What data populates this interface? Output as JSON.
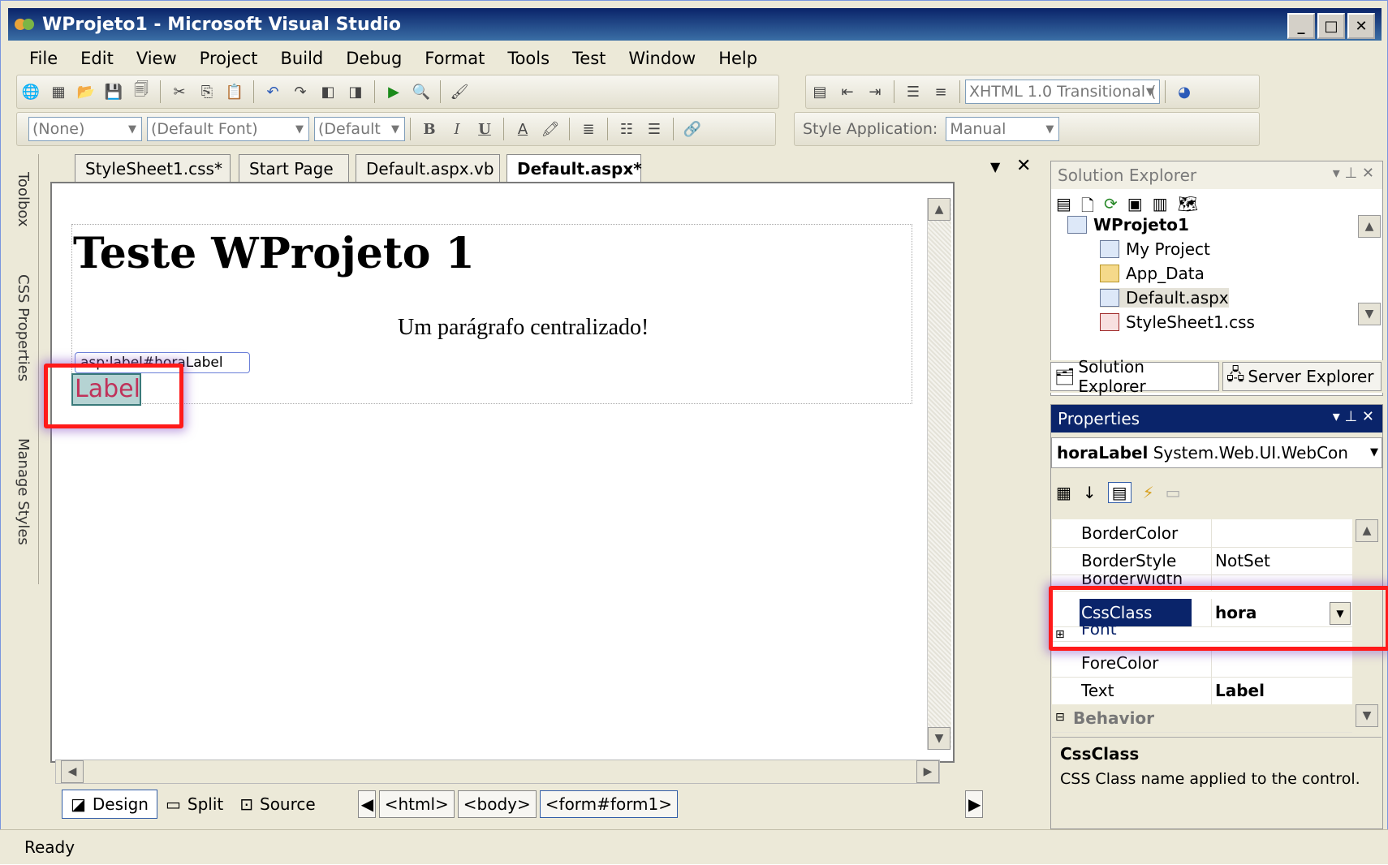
{
  "window": {
    "title": "WProjeto1 - Microsoft Visual Studio"
  },
  "menu": [
    "File",
    "Edit",
    "View",
    "Project",
    "Build",
    "Debug",
    "Format",
    "Tools",
    "Test",
    "Window",
    "Help"
  ],
  "toolbar": {
    "doctype": "XHTML 1.0 Transitional (",
    "block_format": "(None)",
    "font": "(Default Font)",
    "size": "(Default",
    "bold": "B",
    "italic": "I",
    "underline": "U",
    "style_application_label": "Style Application:",
    "style_application_value": "Manual"
  },
  "side_tabs": [
    "Toolbox",
    "CSS Properties",
    "Manage Styles"
  ],
  "doc_tabs": [
    "StyleSheet1.css*",
    "Start Page",
    "Default.aspx.vb",
    "Default.aspx*"
  ],
  "editor": {
    "heading": "Teste WProjeto 1",
    "paragraph": "Um parágrafo centralizado!",
    "label_tag": "asp:label#horaLabel",
    "label_text": "Label"
  },
  "view_buttons": [
    "Design",
    "Split",
    "Source"
  ],
  "breadcrumbs": [
    "<html>",
    "<body>",
    "<form#form1>"
  ],
  "status": "Ready",
  "solution_explorer": {
    "title": "Solution Explorer",
    "items": [
      "WProjeto1",
      "My Project",
      "App_Data",
      "Default.aspx",
      "StyleSheet1.css"
    ],
    "tabs": [
      "Solution Explorer",
      "Server Explorer"
    ]
  },
  "properties": {
    "title": "Properties",
    "object_name": "horaLabel",
    "object_type": "System.Web.UI.WebCon",
    "rows": [
      {
        "name": "BorderColor",
        "value": ""
      },
      {
        "name": "BorderStyle",
        "value": "NotSet"
      },
      {
        "name": "BorderWidth",
        "value": ""
      },
      {
        "name": "CssClass",
        "value": "hora"
      },
      {
        "name": "Font",
        "value": ""
      },
      {
        "name": "ForeColor",
        "value": ""
      },
      {
        "name": "Text",
        "value": "Label"
      },
      {
        "name": "Behavior",
        "value": ""
      }
    ],
    "description_title": "CssClass",
    "description_text": "CSS Class name applied to the control."
  },
  "colors": {
    "title_bar": "#0a246a",
    "highlight": "#ff1a1a",
    "label_text": "#c0325a",
    "selected_row": "#0a246a"
  }
}
